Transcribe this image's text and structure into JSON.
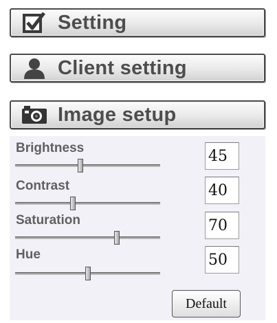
{
  "menu": {
    "setting": {
      "label": "Setting",
      "icon": "checkbox-checked-icon"
    },
    "client_setting": {
      "label": "Client setting",
      "icon": "user-silhouette-icon"
    },
    "image_setup": {
      "label": "Image setup",
      "icon": "camera-icon"
    }
  },
  "image_setup": {
    "controls": [
      {
        "label": "Brightness",
        "value": "45",
        "slider_fraction": 0.45
      },
      {
        "label": "Contrast",
        "value": "40",
        "slider_fraction": 0.4
      },
      {
        "label": "Saturation",
        "value": "70",
        "slider_fraction": 0.7
      },
      {
        "label": "Hue",
        "value": "50",
        "slider_fraction": 0.5
      }
    ],
    "default_button_label": "Default"
  }
}
